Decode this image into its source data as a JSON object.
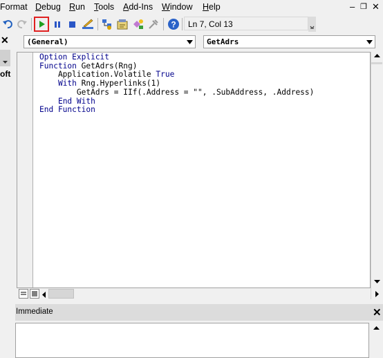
{
  "menu": {
    "items": [
      {
        "pre": "",
        "ul": "",
        "post": "Format"
      },
      {
        "pre": "",
        "ul": "D",
        "post": "ebug"
      },
      {
        "pre": "",
        "ul": "R",
        "post": "un"
      },
      {
        "pre": "",
        "ul": "T",
        "post": "ools"
      },
      {
        "pre": "",
        "ul": "A",
        "post": "dd-Ins"
      },
      {
        "pre": "",
        "ul": "W",
        "post": "indow"
      },
      {
        "pre": "",
        "ul": "H",
        "post": "elp"
      }
    ],
    "min_glyph": "–",
    "restore_glyph": "❐",
    "close_glyph": "✕"
  },
  "toolbar": {
    "position_text": "Ln 7, Col 13",
    "run_highlight_color": "#e02020"
  },
  "left_panel": {
    "close_glyph": "✕",
    "partial_text": "oft"
  },
  "code_window": {
    "object_combo": "(General)",
    "procedure_combo": "GetAdrs",
    "lines": [
      [
        {
          "t": "Option Explicit",
          "c": "kw"
        }
      ],
      [
        {
          "t": "Function ",
          "c": "kw"
        },
        {
          "t": "GetAdrs(Rng)",
          "c": ""
        }
      ],
      [
        {
          "t": "    Application.Volatile ",
          "c": ""
        },
        {
          "t": "True",
          "c": "kw"
        }
      ],
      [
        {
          "t": "    ",
          "c": ""
        },
        {
          "t": "With ",
          "c": "kw"
        },
        {
          "t": "Rng.Hyperlinks(1)",
          "c": ""
        }
      ],
      [
        {
          "t": "        GetAdrs = IIf(.Address = \"\", .SubAddress, .Address)",
          "c": ""
        }
      ],
      [
        {
          "t": "    ",
          "c": ""
        },
        {
          "t": "End With",
          "c": "kw"
        }
      ],
      [
        {
          "t": "End Function",
          "c": "kw"
        }
      ]
    ]
  },
  "immediate": {
    "title": "Immediate",
    "close_glyph": "✕"
  },
  "colors": {
    "keyword": "#00008b",
    "window_bg": "#f0f0f0"
  }
}
